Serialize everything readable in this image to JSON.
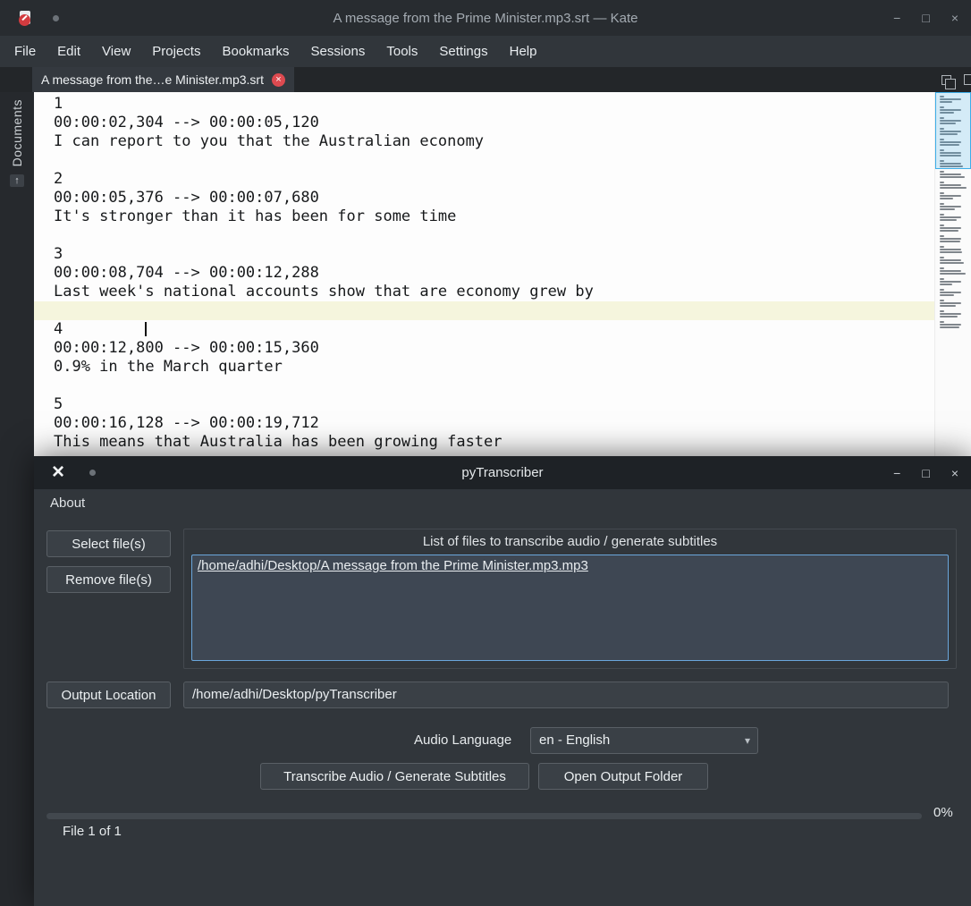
{
  "icons": {
    "minimize": "−",
    "maximize": "□",
    "close": "×",
    "tab_close": "×",
    "dropdown": "▾",
    "app_x": "×",
    "sidebar_arrow": "↑"
  },
  "kate": {
    "titlebar": {
      "title": "A message from the Prime Minister.mp3.srt — Kate"
    },
    "menu": [
      "File",
      "Edit",
      "View",
      "Projects",
      "Bookmarks",
      "Sessions",
      "Tools",
      "Settings",
      "Help"
    ],
    "tab_label": "A message from the…e Minister.mp3.srt",
    "sidebar_documents": "Documents",
    "editor_lines": [
      "1",
      "00:00:02,304 --> 00:00:05,120",
      "I can report to you that the Australian economy",
      "",
      "2",
      "00:00:05,376 --> 00:00:07,680",
      "It's stronger than it has been for some time",
      "",
      "3",
      "00:00:08,704 --> 00:00:12,288",
      "Last week's national accounts show that are economy grew by",
      "",
      "4",
      "00:00:12,800 --> 00:00:15,360",
      "0.9% in the March quarter",
      "",
      "5",
      "00:00:16,128 --> 00:00:19,712",
      "This means that Australia has been growing faster"
    ]
  },
  "pyt": {
    "title": "pyTranscriber",
    "menu_about": "About",
    "select_files": "Select file(s)",
    "remove_files": "Remove file(s)",
    "list_title": "List of files to transcribe audio / generate subtitles",
    "file_item": "/home/adhi/Desktop/A message from the Prime Minister.mp3.mp3",
    "output_location": "Output Location",
    "output_path": "/home/adhi/Desktop/pyTranscriber",
    "audio_language_label": "Audio Language",
    "audio_language_value": "en - English",
    "transcribe": "Transcribe Audio / Generate Subtitles",
    "open_output": "Open Output Folder",
    "progress_text": "0%",
    "file_counter": "File 1 of 1"
  }
}
